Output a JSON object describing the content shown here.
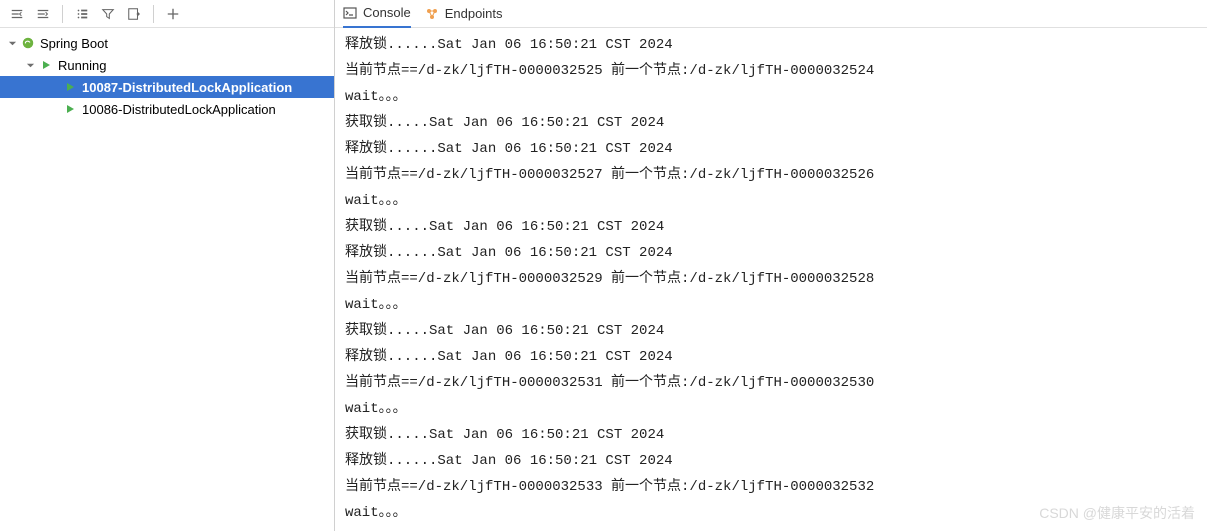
{
  "tree": {
    "root_label": "Spring Boot",
    "running_label": "Running",
    "apps": [
      {
        "label": "10087-DistributedLockApplication",
        "selected": true
      },
      {
        "label": "10086-DistributedLockApplication",
        "selected": false
      }
    ]
  },
  "tabs": {
    "console": "Console",
    "endpoints": "Endpoints"
  },
  "console_lines": [
    "释放锁......Sat Jan 06 16:50:21 CST 2024",
    "当前节点==/d-zk/ljfTH-0000032525 前一个节点:/d-zk/ljfTH-0000032524",
    "wait。。。",
    "获取锁.....Sat Jan 06 16:50:21 CST 2024",
    "释放锁......Sat Jan 06 16:50:21 CST 2024",
    "当前节点==/d-zk/ljfTH-0000032527 前一个节点:/d-zk/ljfTH-0000032526",
    "wait。。。",
    "获取锁.....Sat Jan 06 16:50:21 CST 2024",
    "释放锁......Sat Jan 06 16:50:21 CST 2024",
    "当前节点==/d-zk/ljfTH-0000032529 前一个节点:/d-zk/ljfTH-0000032528",
    "wait。。。",
    "获取锁.....Sat Jan 06 16:50:21 CST 2024",
    "释放锁......Sat Jan 06 16:50:21 CST 2024",
    "当前节点==/d-zk/ljfTH-0000032531 前一个节点:/d-zk/ljfTH-0000032530",
    "wait。。。",
    "获取锁.....Sat Jan 06 16:50:21 CST 2024",
    "释放锁......Sat Jan 06 16:50:21 CST 2024",
    "当前节点==/d-zk/ljfTH-0000032533 前一个节点:/d-zk/ljfTH-0000032532",
    "wait。。。"
  ],
  "watermark": "CSDN @健康平安的活着"
}
